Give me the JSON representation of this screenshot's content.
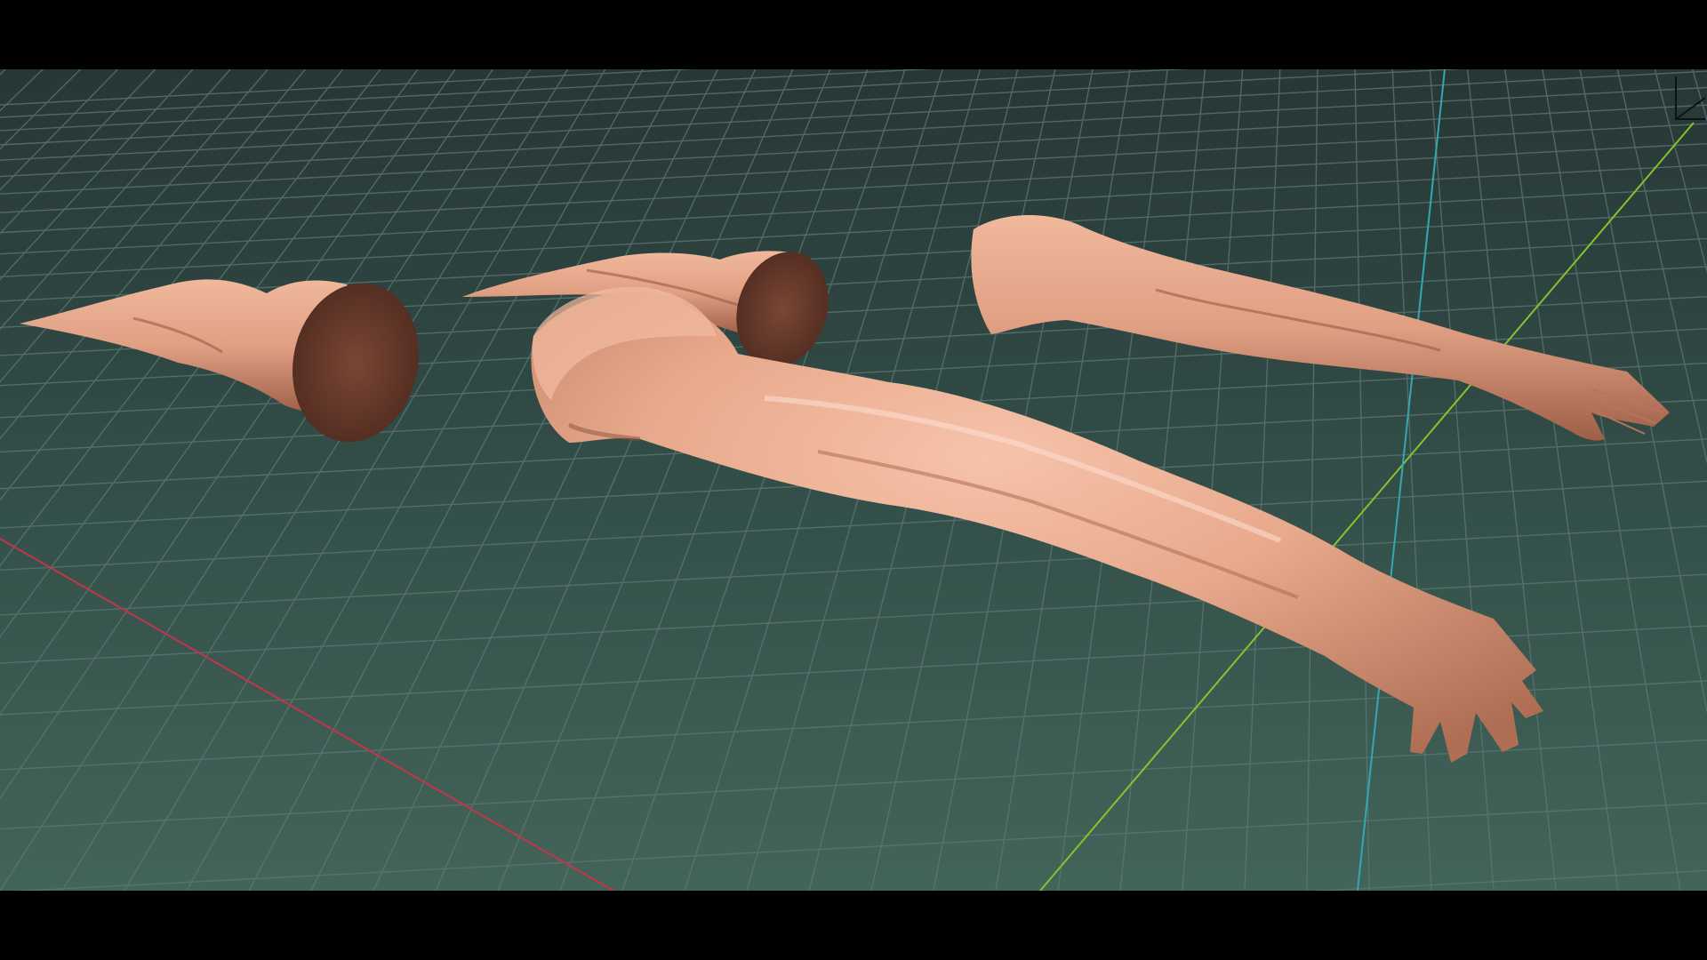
{
  "viewport": {
    "background_top": "#2a3b3b",
    "background_bottom": "#3f5e55",
    "grid_line_color": "#5f7873",
    "axis_x_color": "#c8334a",
    "axis_y_color": "#7fbf2a",
    "axis_z_color": "#2fa3b3",
    "letterbox_color": "#000000"
  },
  "scene": {
    "objects": [
      {
        "name": "arm-model-1",
        "material": "skin",
        "color": "#e09f83"
      },
      {
        "name": "arm-model-2",
        "material": "skin",
        "color": "#e09f83"
      },
      {
        "name": "arm-model-3",
        "material": "skin",
        "color": "#e09f83"
      },
      {
        "name": "arm-model-4",
        "material": "skin",
        "color": "#e8a98c"
      }
    ]
  },
  "gizmo": {
    "icon": "axis-orientation-icon"
  }
}
